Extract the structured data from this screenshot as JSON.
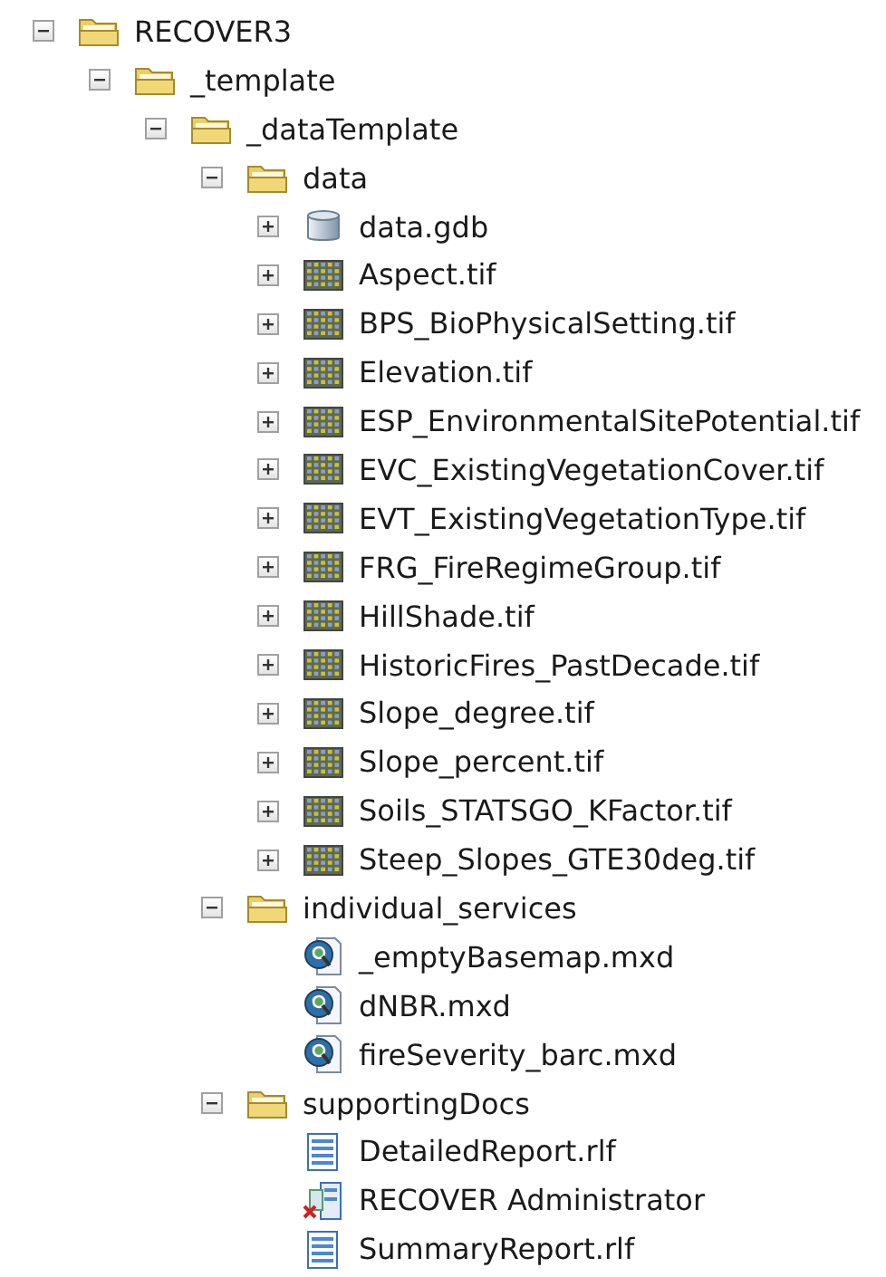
{
  "tree": [
    {
      "label": "RECOVER3",
      "kind": "folder",
      "expanded": true,
      "children": [
        {
          "label": "_template",
          "kind": "folder",
          "expanded": true,
          "children": [
            {
              "label": "_dataTemplate",
              "kind": "folder",
              "expanded": true,
              "children": [
                {
                  "label": "data",
                  "kind": "folder",
                  "expanded": true,
                  "children": [
                    {
                      "label": "data.gdb",
                      "kind": "database",
                      "expanded": false
                    },
                    {
                      "label": "Aspect.tif",
                      "kind": "raster",
                      "expanded": false
                    },
                    {
                      "label": "BPS_BioPhysicalSetting.tif",
                      "kind": "raster",
                      "expanded": false
                    },
                    {
                      "label": "Elevation.tif",
                      "kind": "raster",
                      "expanded": false
                    },
                    {
                      "label": "ESP_EnvironmentalSitePotential.tif",
                      "kind": "raster",
                      "expanded": false
                    },
                    {
                      "label": "EVC_ExistingVegetationCover.tif",
                      "kind": "raster",
                      "expanded": false
                    },
                    {
                      "label": "EVT_ExistingVegetationType.tif",
                      "kind": "raster",
                      "expanded": false
                    },
                    {
                      "label": "FRG_FireRegimeGroup.tif",
                      "kind": "raster",
                      "expanded": false
                    },
                    {
                      "label": "HillShade.tif",
                      "kind": "raster",
                      "expanded": false
                    },
                    {
                      "label": "HistoricFires_PastDecade.tif",
                      "kind": "raster",
                      "expanded": false
                    },
                    {
                      "label": "Slope_degree.tif",
                      "kind": "raster",
                      "expanded": false
                    },
                    {
                      "label": "Slope_percent.tif",
                      "kind": "raster",
                      "expanded": false
                    },
                    {
                      "label": "Soils_STATSGO_KFactor.tif",
                      "kind": "raster",
                      "expanded": false
                    },
                    {
                      "label": "Steep_Slopes_GTE30deg.tif",
                      "kind": "raster",
                      "expanded": false
                    }
                  ]
                },
                {
                  "label": "individual_services",
                  "kind": "folder",
                  "expanded": true,
                  "children": [
                    {
                      "label": "_emptyBasemap.mxd",
                      "kind": "map"
                    },
                    {
                      "label": "dNBR.mxd",
                      "kind": "map"
                    },
                    {
                      "label": "fireSeverity_barc.mxd",
                      "kind": "map"
                    }
                  ]
                },
                {
                  "label": "supportingDocs",
                  "kind": "folder",
                  "expanded": true,
                  "children": [
                    {
                      "label": "DetailedReport.rlf",
                      "kind": "report"
                    },
                    {
                      "label": "RECOVER Administrator",
                      "kind": "tool"
                    },
                    {
                      "label": "SummaryReport.rlf",
                      "kind": "report"
                    }
                  ]
                }
              ]
            }
          ]
        }
      ]
    }
  ]
}
